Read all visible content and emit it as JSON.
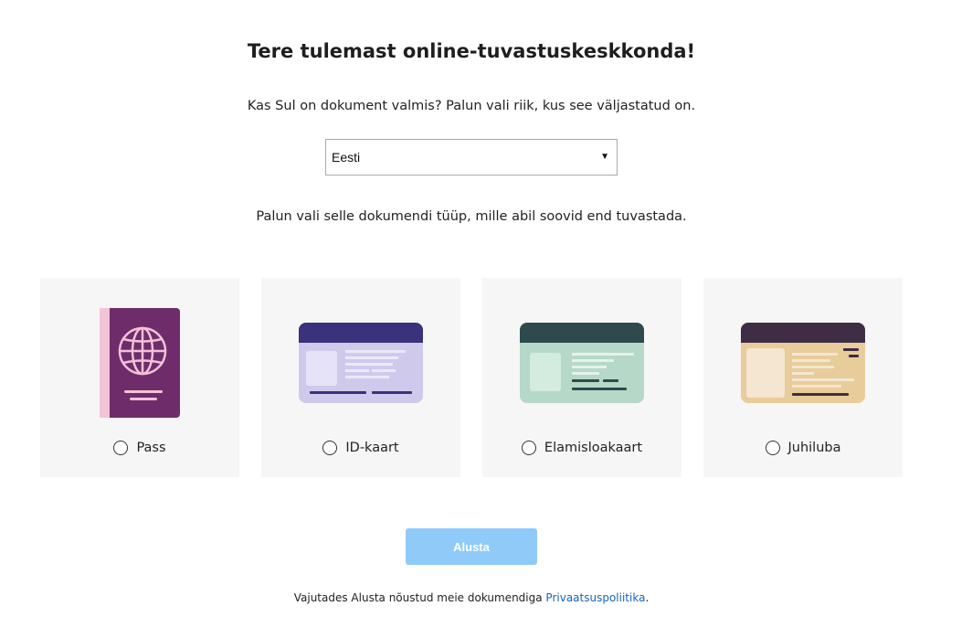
{
  "header": {
    "title": "Tere tulemast online-tuvastuskeskkonda!",
    "subtitle": "Kas Sul on dokument valmis? Palun vali riik, kus see väljastatud on."
  },
  "country_select": {
    "selected": "Eesti"
  },
  "document_prompt": "Palun vali selle dokumendi tüüp, mille abil soovid end tuvastada.",
  "documents": [
    {
      "label": "Pass",
      "icon": "passport-icon",
      "selected": false
    },
    {
      "label": "ID-kaart",
      "icon": "id-card-icon",
      "selected": false
    },
    {
      "label": "Elamisloakaart",
      "icon": "residence-card-icon",
      "selected": false
    },
    {
      "label": "Juhiluba",
      "icon": "driving-license-icon",
      "selected": false
    }
  ],
  "start_button": {
    "label": "Alusta",
    "color": "#90caf9"
  },
  "footer": {
    "text": "Vajutades Alusta nõustud meie dokumendiga ",
    "link": "Privaatsuspoliitika",
    "suffix": "."
  },
  "colors": {
    "passport": "#6e2d6a",
    "id_card_header": "#3a327a",
    "id_card_body": "#cfcaec",
    "residence_header": "#2e4a4d",
    "residence_body": "#b6d8c8",
    "license_header": "#3f2c45",
    "license_body": "#e8cc9a"
  }
}
